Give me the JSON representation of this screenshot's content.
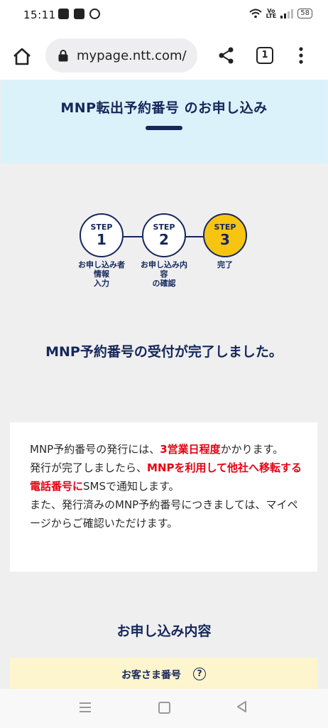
{
  "status_bar": {
    "time": "15:11",
    "battery": "58"
  },
  "browser": {
    "url": "mypage.ntt.com/",
    "tab_count": "1"
  },
  "header": {
    "title": "MNP転出予約番号 のお申し込み"
  },
  "steps": [
    {
      "label": "STEP",
      "number": "1",
      "caption": "お申し込み者\n情報\n入力",
      "active": false
    },
    {
      "label": "STEP",
      "number": "2",
      "caption": "お申し込み内\n容\nの確認",
      "active": false
    },
    {
      "label": "STEP",
      "number": "3",
      "caption": "完了",
      "active": true
    }
  ],
  "completion": {
    "heading": "MNP予約番号の受付が完了しました。"
  },
  "info": {
    "p1_a": "MNP予約番号の発行には、",
    "p1_red": "3営業日程度",
    "p1_b": "かかります。",
    "p2_a": "発行が完了しましたら、",
    "p2_red": "MNPを利用して他社へ移転する電話番号に",
    "p2_b": "SMSで通知します。",
    "p3": "また、発行済みのMNP予約番号につきましては、マイページからご確認いただけます。"
  },
  "application": {
    "heading": "お申し込み内容",
    "customer_label": "お客さま番号",
    "help_symbol": "?"
  },
  "colors": {
    "navy": "#15285b",
    "header_bg": "#dbf2fb",
    "active_step": "#f7c412",
    "red_text": "#e60012",
    "customer_row_bg": "#fcf5cd"
  }
}
